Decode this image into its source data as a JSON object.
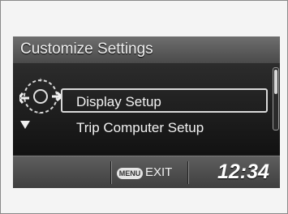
{
  "screen": {
    "title": "Customize Settings",
    "menu_items": [
      {
        "label": "Display Setup",
        "selected": true
      },
      {
        "label": "Trip Computer Setup",
        "selected": false
      }
    ],
    "bottom": {
      "menu_badge": "MENU",
      "exit_label": "EXIT",
      "time": "12:34"
    },
    "icons": {
      "dial": "selector-dial-icon",
      "back": "back-arrow-icon",
      "down": "down-arrow-icon"
    }
  }
}
